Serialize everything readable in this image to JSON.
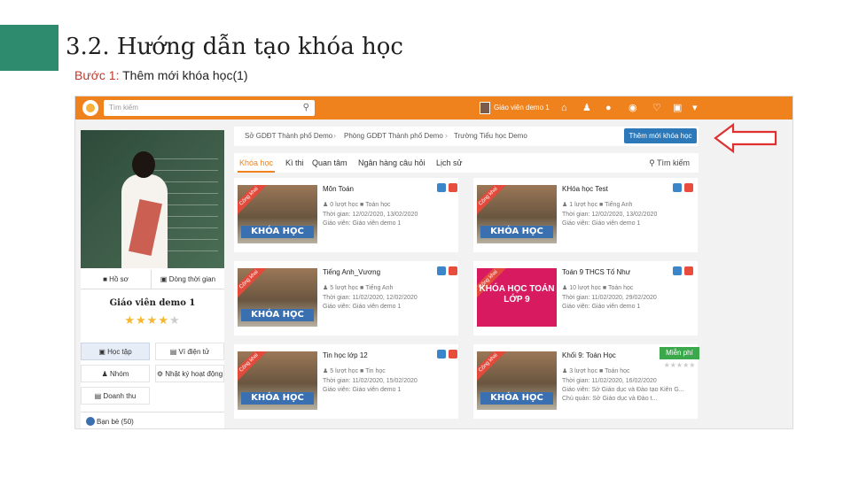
{
  "slide": {
    "title": "3.2. Hướng dẫn tạo khóa học",
    "step_label": "Bước 1:",
    "step_text": " Thêm mới khóa học(1)"
  },
  "app": {
    "search_placeholder": "Tìm kiếm",
    "user_name": "Giáo viên demo 1",
    "accent_color": "#f0821e",
    "icons": [
      "home-icon",
      "users-icon",
      "chat-icon",
      "globe-icon",
      "bell-icon",
      "box-icon",
      "dropdown-icon"
    ]
  },
  "profile": {
    "btn_profile": "Hồ sơ",
    "btn_timeline": "Dòng thời gian",
    "name": "Giáo viên demo 1",
    "rating": 4,
    "menu": [
      {
        "label": "Học tập"
      },
      {
        "label": "Ví điện tử"
      },
      {
        "label": "Nhóm"
      },
      {
        "label": "Nhật ký hoạt động"
      },
      {
        "label": "Doanh thu"
      }
    ],
    "friends": "Bạn bè (50)"
  },
  "breadcrumb": [
    "Sở GDĐT Thành phố Demo",
    "Phòng GDĐT Thành phố Demo",
    "Trường Tiểu học Demo"
  ],
  "create_button": "Thêm mới khóa học",
  "tabs": [
    "Khóa học",
    "Kì thi",
    "Quan tâm",
    "Ngân hàng câu hỏi",
    "Lịch sử"
  ],
  "tab_search": "Tìm kiếm",
  "thumb_banner": "KHÓA HỌC",
  "thumb_ribbon": "Công khai",
  "pink_thumb": "KHÓA HỌC TOÁN LỚP 9",
  "courses": [
    {
      "title": "Môn Toán",
      "learns": "0 lượt học",
      "subject": "Toán học",
      "time": "Thời gian: 12/02/2020, 13/02/2020",
      "teacher": "Giáo viên: Giáo viên demo 1"
    },
    {
      "title": "KHóa học Test",
      "learns": "1 lượt học",
      "subject": "Tiếng Anh",
      "time": "Thời gian: 12/02/2020, 13/02/2020",
      "teacher": "Giáo viên: Giáo viên demo 1"
    },
    {
      "title": "Tiếng Anh_Vương",
      "learns": "5 lượt học",
      "subject": "Tiếng Anh",
      "time": "Thời gian: 11/02/2020, 12/02/2020",
      "teacher": "Giáo viên: Giáo viên demo 1"
    },
    {
      "title": "Toán 9 THCS Tố Như",
      "learns": "10 lượt học",
      "subject": "Toán học",
      "time": "Thời gian: 11/02/2020, 29/02/2020",
      "teacher": "Giáo viên: Giáo viên demo 1"
    },
    {
      "title": "Tin học lớp 12",
      "learns": "5 lượt học",
      "subject": "Tin học",
      "time": "Thời gian: 11/02/2020, 15/02/2020",
      "teacher": "Giáo viên: Giáo viên demo 1"
    },
    {
      "title": "Khối 9: Toán Học",
      "learns": "3 lượt học",
      "subject": "Toán học",
      "time": "Thời gian: 11/02/2020, 16/02/2020",
      "teacher": "Giáo viên: Sở Giáo dục và Đào tạo Kiên G...",
      "owner": "Chủ quản: Sở Giáo dục và Đào t..."
    }
  ],
  "free_badge": "Miễn phí"
}
